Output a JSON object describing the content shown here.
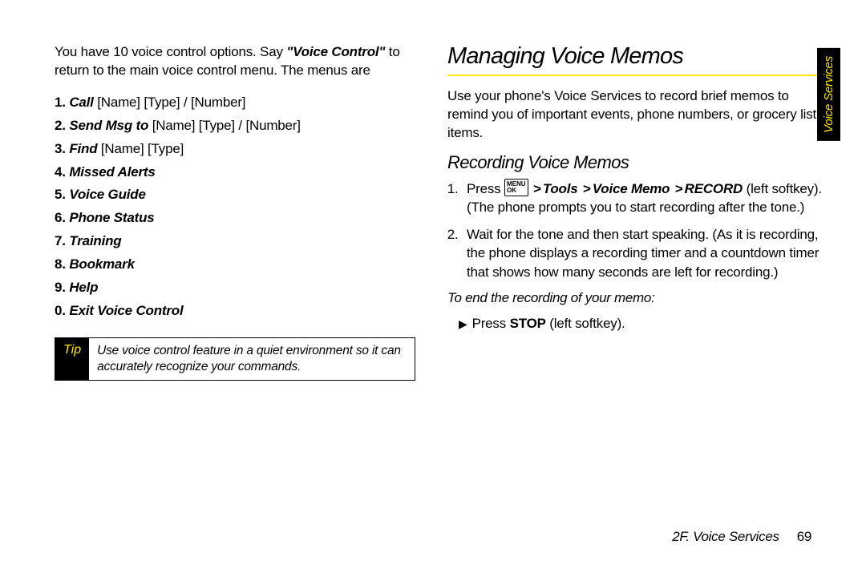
{
  "left": {
    "intro_pre": "You have 10 voice control options. Say ",
    "intro_quote": "\"Voice Control\"",
    "intro_post": " to return to the main voice control menu. The menus are",
    "menu": [
      {
        "n": "1.",
        "cmd": "Call",
        "rest": " [Name] [Type] / [Number]"
      },
      {
        "n": "2.",
        "cmd": "Send Msg to",
        "rest": " [Name] [Type] / [Number]"
      },
      {
        "n": "3.",
        "cmd": "Find",
        "rest": " [Name] [Type]"
      },
      {
        "n": "4.",
        "cmd": "Missed Alerts",
        "rest": ""
      },
      {
        "n": "5.",
        "cmd": "Voice Guide",
        "rest": ""
      },
      {
        "n": "6.",
        "cmd": "Phone Status",
        "rest": ""
      },
      {
        "n": "7.",
        "cmd": "Training",
        "rest": ""
      },
      {
        "n": "8.",
        "cmd": "Bookmark",
        "rest": ""
      },
      {
        "n": "9.",
        "cmd": "Help",
        "rest": ""
      },
      {
        "n": "0.",
        "cmd": "Exit Voice Control",
        "rest": ""
      }
    ],
    "tip_label": "Tip",
    "tip_text": "Use voice control feature in a quiet environment so it can accurately recognize your commands."
  },
  "right": {
    "h1": "Managing Voice Memos",
    "intro": "Use your phone's Voice Services to record brief memos to remind you of important events, phone numbers, or grocery list items.",
    "h2": "Recording Voice Memos",
    "step1_pre": "Press ",
    "step1_key": "MENU\nOK",
    "step1_path_a": "Tools",
    "step1_path_b": "Voice Memo",
    "step1_path_c": "RECORD",
    "step1_post": " (left softkey). (The phone prompts you to start recording after the tone.)",
    "step2": "Wait for the tone and then start speaking. (As it is recording, the phone displays a recording timer and a countdown timer that shows how many seconds are left for recording.)",
    "sub": "To end the recording of your memo:",
    "bullet_pre": "Press ",
    "bullet_bold": "STOP",
    "bullet_post": " (left softkey)."
  },
  "footer": {
    "section": "2F. Voice Services",
    "page": "69"
  },
  "sidetab": "Voice Services"
}
